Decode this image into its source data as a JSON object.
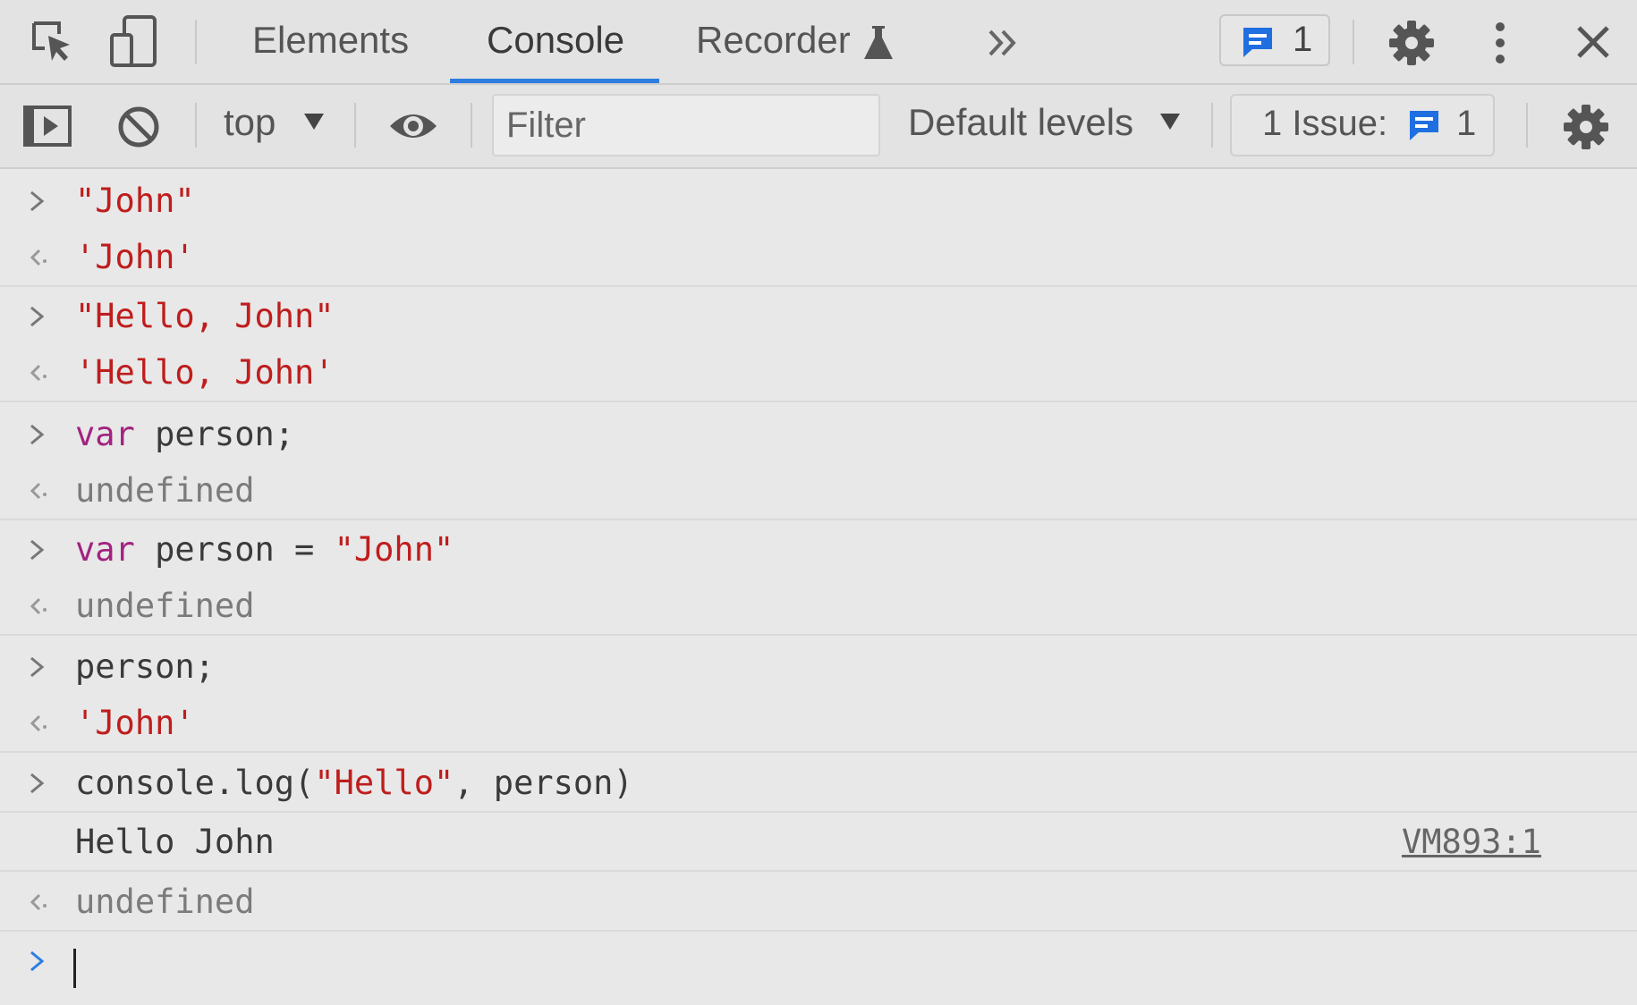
{
  "tabs": [
    {
      "label": "Elements"
    },
    {
      "label": "Console",
      "active": true
    },
    {
      "label": "Recorder"
    }
  ],
  "header": {
    "message_count": "1"
  },
  "toolbar": {
    "context": "top",
    "filter_placeholder": "Filter",
    "levels": "Default levels",
    "issues_label": "1 Issue:",
    "issues_count": "1"
  },
  "console": {
    "entries": [
      {
        "type": "input",
        "text": "\"John\""
      },
      {
        "type": "result",
        "text": "'John'"
      },
      {
        "type": "input",
        "text": "\"Hello, John\""
      },
      {
        "type": "result",
        "text": "'Hello, John'"
      },
      {
        "type": "input",
        "keyword": "var",
        "text": "person;"
      },
      {
        "type": "result",
        "text": "undefined"
      },
      {
        "type": "input",
        "keyword": "var",
        "text": "person =",
        "string": "\"John\""
      },
      {
        "type": "result",
        "text": "undefined"
      },
      {
        "type": "input",
        "text": "person;"
      },
      {
        "type": "result",
        "text": "'John'"
      },
      {
        "type": "input",
        "prefix": "console.log(",
        "string": "\"Hello\"",
        "suffix": ", person)"
      },
      {
        "type": "log",
        "text": "Hello John",
        "source": "VM893:1"
      },
      {
        "type": "result",
        "text": "undefined"
      }
    ]
  },
  "colors": {
    "accent": "#2d7ee0",
    "string": "#bf1d1d",
    "keyword": "#a2237f"
  },
  "icons": [
    "inspect-element-icon",
    "device-toggle-icon",
    "more-tabs-icon",
    "message-icon",
    "gear-icon",
    "kebab-menu-icon",
    "close-icon",
    "sidebar-toggle-icon",
    "clear-console-icon",
    "eye-icon"
  ]
}
